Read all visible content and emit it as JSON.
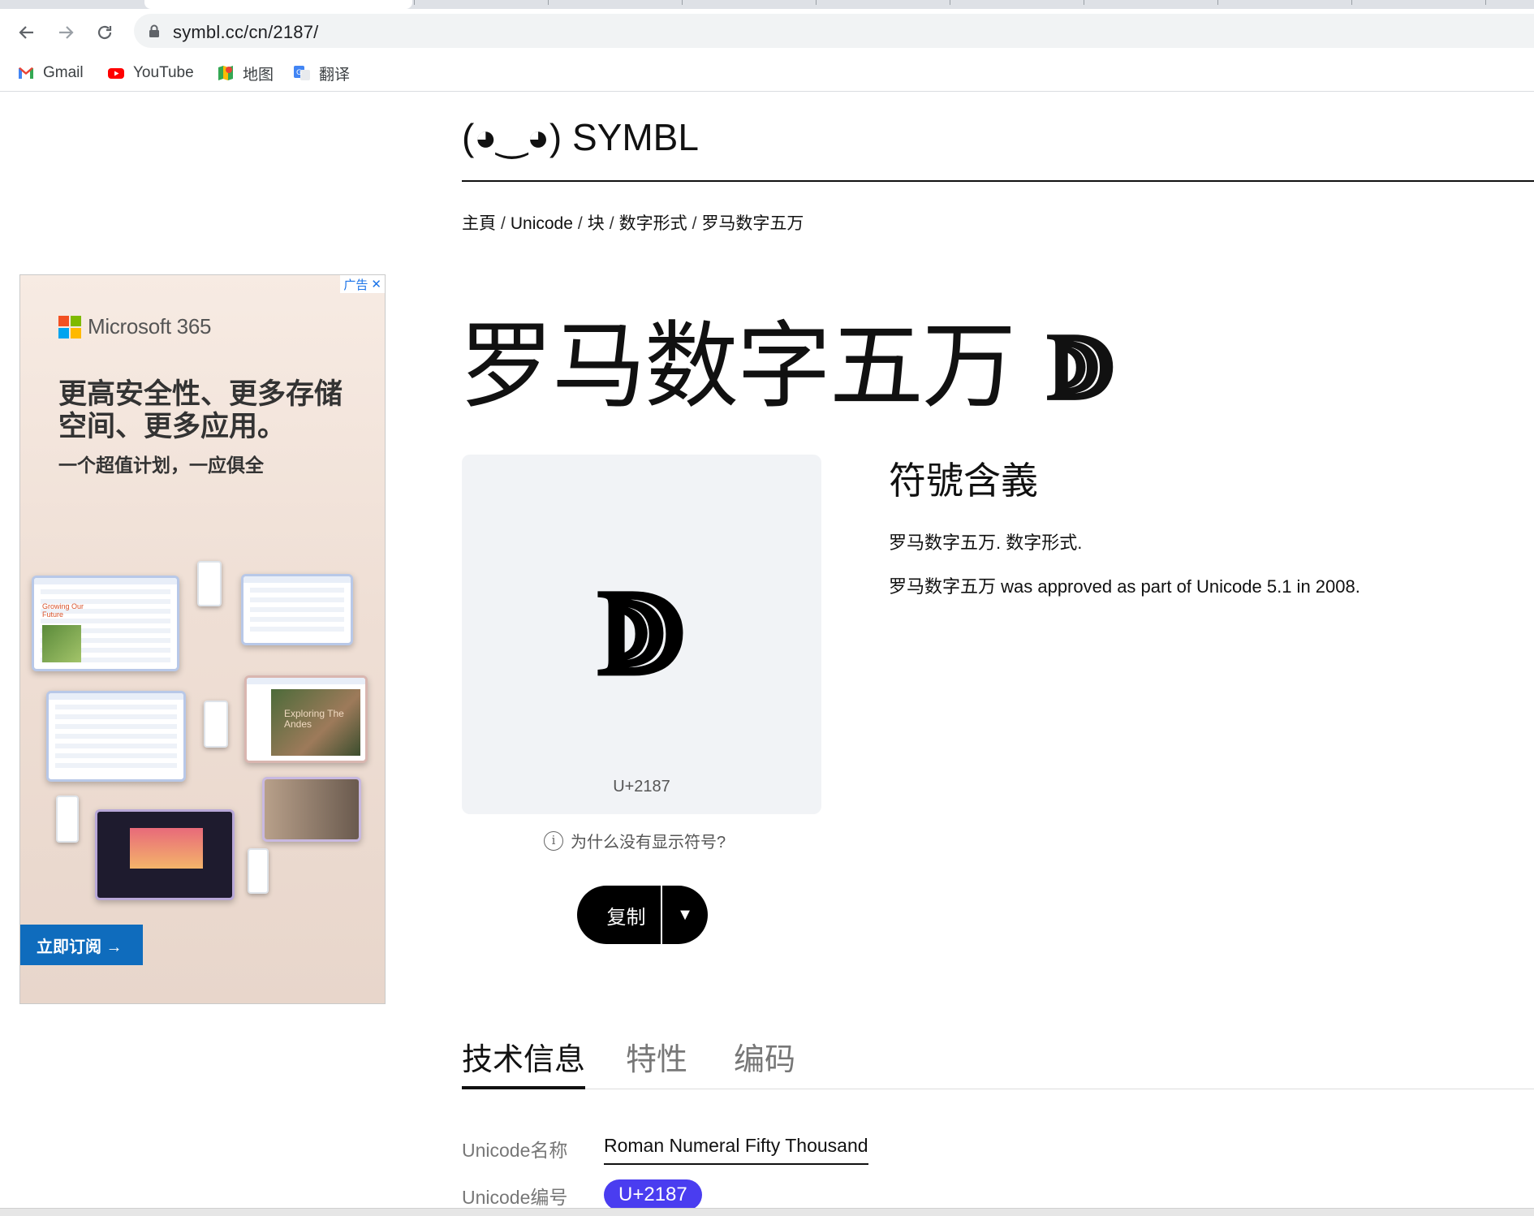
{
  "browser": {
    "url": "symbl.cc/cn/2187/",
    "bookmarks": [
      {
        "label": "Gmail",
        "icon": "gmail-icon"
      },
      {
        "label": "YouTube",
        "icon": "youtube-icon"
      },
      {
        "label": "地图",
        "icon": "maps-icon"
      },
      {
        "label": "翻译",
        "icon": "translate-icon"
      }
    ]
  },
  "ad": {
    "choice_label": "广告",
    "brand": "Microsoft 365",
    "headline": "更高安全性、更多存储空间、更多应用。",
    "subline": "一个超值计划，一应俱全",
    "cta": "立即订阅 →",
    "screens": [
      "Growing Our Future",
      "Exploring The Andes"
    ]
  },
  "site": {
    "logo": "(◕‿◕) SYMBL"
  },
  "breadcrumb": [
    "主頁",
    "Unicode",
    "块",
    "数字形式",
    "罗马数字五万"
  ],
  "symbol": {
    "title": "罗马数字五万",
    "char": "ↇ",
    "code": "U+2187",
    "why_label": "为什么没有显示符号?",
    "copy_label": "复制",
    "copy_dropdown": "▼"
  },
  "meaning": {
    "title": "符號含義",
    "p1": "罗马数字五万. 数字形式.",
    "p2": "罗马数字五万 was approved as part of Unicode 5.1 in 2008."
  },
  "tabs": [
    "技术信息",
    "特性",
    "编码"
  ],
  "tech": [
    {
      "key": "Unicode名称",
      "value": "Roman Numeral Fifty Thousand"
    },
    {
      "key": "Unicode编号",
      "value": "U+2187"
    }
  ],
  "colors": {
    "accent": "#4a3df0",
    "ad_cta": "#0f6cbd"
  }
}
